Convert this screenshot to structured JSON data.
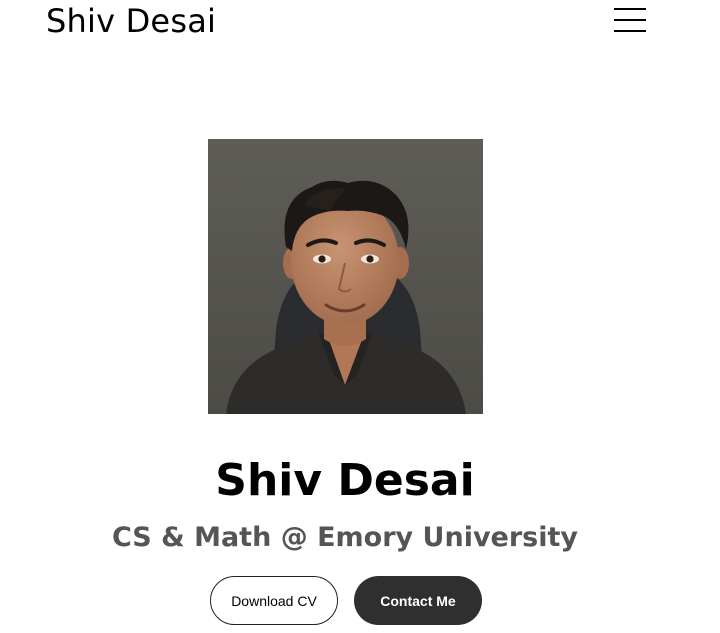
{
  "header": {
    "logo_text": "Shiv Desai",
    "menu_icon": "hamburger-menu-icon"
  },
  "profile": {
    "photo_alt": "Profile photo of Shiv Desai",
    "name": "Shiv Desai",
    "subtitle": "CS & Math @ Emory University"
  },
  "buttons": {
    "download_cv": "Download CV",
    "contact_me": "Contact Me"
  },
  "colors": {
    "background": "#ffffff",
    "text": "#000000",
    "subtitle": "#555555",
    "primary_button": "#2f2f2f",
    "photo_background": "#5b5a55"
  }
}
